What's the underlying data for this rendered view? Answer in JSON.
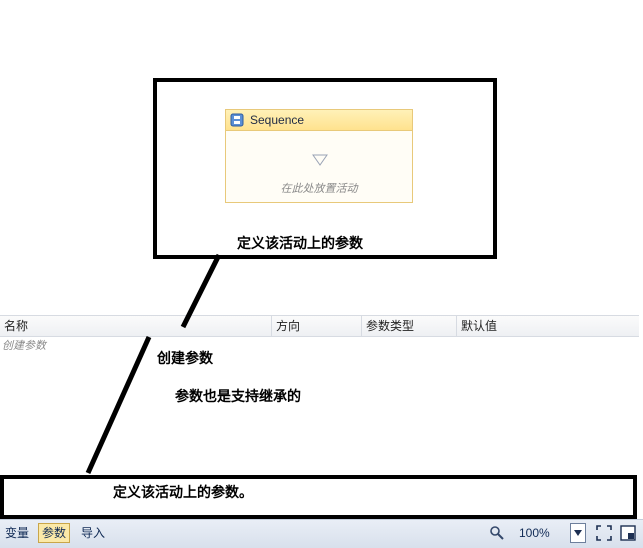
{
  "designer": {
    "sequence_title": "Sequence",
    "drop_hint": "在此处放置活动"
  },
  "annotations": {
    "top_label": "定义该活动上的参数",
    "create_label": "创建参数",
    "inherit_label": "参数也是支持继承的",
    "bottom_label": "定义该活动上的参数。"
  },
  "arguments_grid": {
    "columns": [
      "名称",
      "方向",
      "参数类型",
      "默认值"
    ],
    "create_row": "创建参数"
  },
  "statusbar": {
    "tabs": [
      "变量",
      "参数",
      "导入"
    ],
    "active_tab": "参数",
    "zoom": "100%"
  },
  "colors": {
    "sequence_border": "#e8c97a",
    "sequence_header": "#ffe28e",
    "statusbar_bg": "#dbe3ee",
    "active_tab_bg": "#fbe9a8"
  },
  "icons": [
    "sequence-icon",
    "drop-arrow-icon",
    "search-icon",
    "dropdown-icon",
    "fit-to-screen-icon",
    "overview-icon"
  ]
}
